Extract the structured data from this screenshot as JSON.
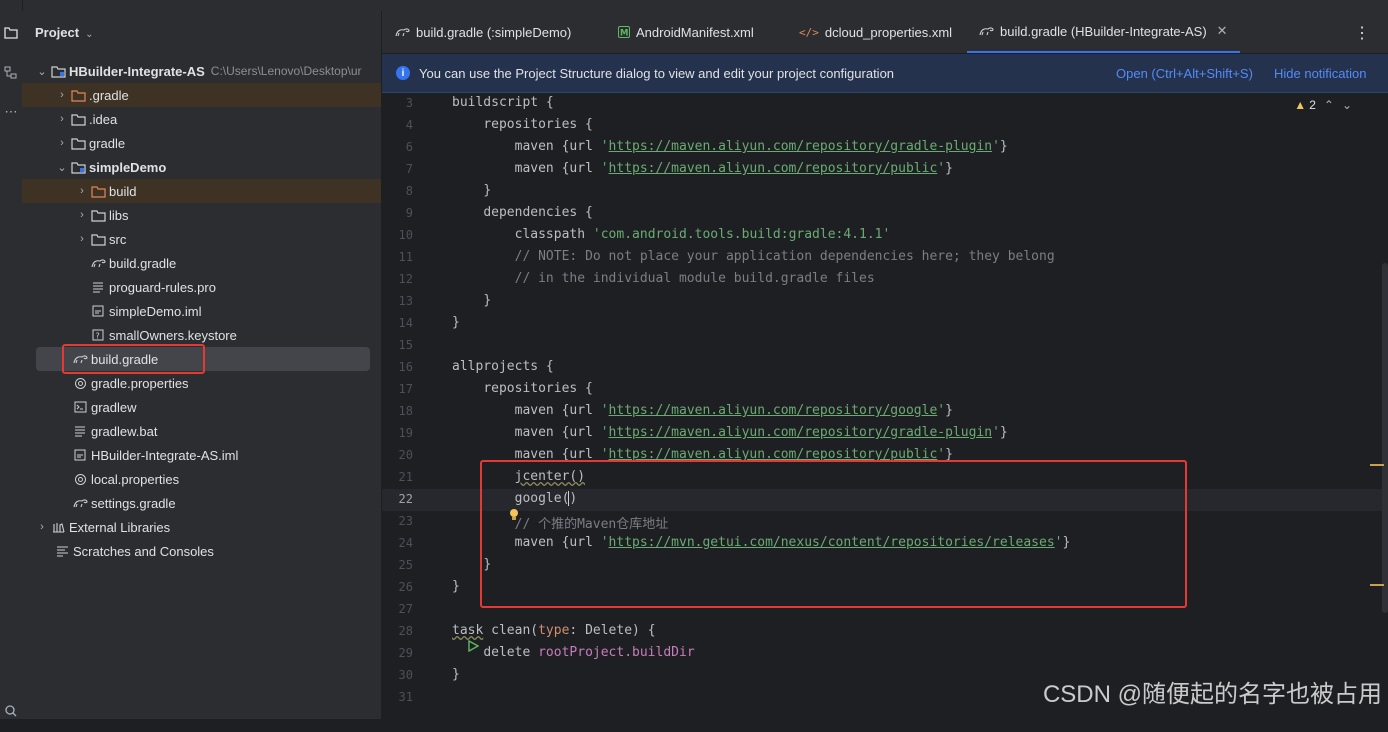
{
  "colors": {
    "accent": "#3574f0",
    "highlight_box": "#e53935",
    "string": "#6aab73",
    "comment": "#7a7e85",
    "keyword": "#cf8e6d",
    "property": "#c77dbb"
  },
  "project_panel": {
    "title": "Project",
    "tree": [
      {
        "label": "HBuilder-Integrate-AS",
        "hint": "C:\\Users\\Lenovo\\Desktop\\ur",
        "icon": "module-folder-icon"
      },
      {
        "label": ".gradle",
        "icon": "folder-icon"
      },
      {
        "label": ".idea",
        "icon": "folder-icon"
      },
      {
        "label": "gradle",
        "icon": "folder-icon"
      },
      {
        "label": "simpleDemo",
        "icon": "module-folder-icon"
      },
      {
        "label": "build",
        "icon": "folder-icon"
      },
      {
        "label": "libs",
        "icon": "folder-icon"
      },
      {
        "label": "src",
        "icon": "folder-icon"
      },
      {
        "label": "build.gradle",
        "icon": "gradle-icon"
      },
      {
        "label": "proguard-rules.pro",
        "icon": "text-file-icon"
      },
      {
        "label": "simpleDemo.iml",
        "icon": "iml-file-icon"
      },
      {
        "label": "smallOwners.keystore",
        "icon": "unknown-file-icon"
      },
      {
        "label": "build.gradle",
        "icon": "gradle-icon"
      },
      {
        "label": "gradle.properties",
        "icon": "settings-file-icon"
      },
      {
        "label": "gradlew",
        "icon": "terminal-file-icon"
      },
      {
        "label": "gradlew.bat",
        "icon": "text-file-icon"
      },
      {
        "label": "HBuilder-Integrate-AS.iml",
        "icon": "iml-file-icon"
      },
      {
        "label": "local.properties",
        "icon": "settings-file-icon"
      },
      {
        "label": "settings.gradle",
        "icon": "gradle-icon"
      },
      {
        "label": "External Libraries",
        "icon": "library-icon"
      },
      {
        "label": "Scratches and Consoles",
        "icon": "scratches-icon"
      }
    ]
  },
  "tabs": [
    {
      "label": "build.gradle (:simpleDemo)",
      "icon": "gradle-icon"
    },
    {
      "label": "AndroidManifest.xml",
      "icon": "manifest-icon"
    },
    {
      "label": "dcloud_properties.xml",
      "icon": "xml-icon"
    },
    {
      "label": "build.gradle (HBuilder-Integrate-AS)",
      "icon": "gradle-icon",
      "active": true
    }
  ],
  "notification": {
    "message": "You can use the Project Structure dialog to view and edit your project configuration",
    "open_link": "Open (Ctrl+Alt+Shift+S)",
    "hide_link": "Hide notification"
  },
  "inspection": {
    "warning_count": "2"
  },
  "editor": {
    "line_numbers": [
      "3",
      "4",
      "6",
      "7",
      "8",
      "9",
      "10",
      "11",
      "12",
      "13",
      "14",
      "15",
      "16",
      "17",
      "18",
      "19",
      "20",
      "21",
      "22",
      "23",
      "24",
      "25",
      "26",
      "27",
      "28",
      "29",
      "30",
      "31"
    ],
    "current_line": "22",
    "code": {
      "buildscript": "buildscript {",
      "repositories": "repositories {",
      "maven_open": "maven {url ",
      "close_brace": "}",
      "url_gradle_plugin": "https://maven.aliyun.com/repository/gradle-plugin",
      "url_public": "https://maven.aliyun.com/repository/public",
      "url_google": "https://maven.aliyun.com/repository/google",
      "url_getui": "https://mvn.getui.com/nexus/content/repositories/releases",
      "dependencies": "dependencies {",
      "classpath": "classpath ",
      "classpath_value": "'com.android.tools.build:gradle:4.1.1'",
      "comment_1": "// NOTE: Do not place your application dependencies here; they belong",
      "comment_2": "// in the individual module build.gradle files",
      "allprojects": "allprojects {",
      "jcenter": "jcenter()",
      "google": "google(",
      "google_close": ")",
      "comment_getui": "// 个推的Maven仓库地址",
      "task_kw": "task",
      "task_rest": " clean(",
      "type_kw": "type",
      "task_tail": ": Delete) {",
      "delete": "delete ",
      "build_dir": "rootProject.buildDir"
    }
  },
  "watermark": "CSDN @随便起的名字也被占用"
}
